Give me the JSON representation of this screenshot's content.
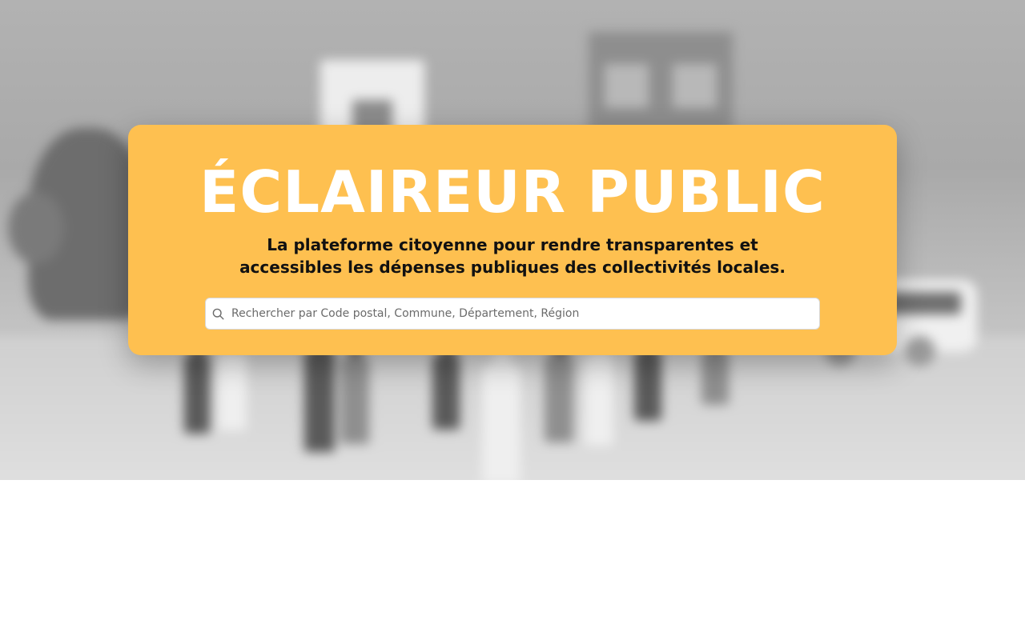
{
  "hero": {
    "title": "ÉCLAIREUR PUBLIC",
    "subtitle": "La plateforme citoyenne pour rendre transparentes et accessibles les dépenses publiques des collectivités locales.",
    "accent_color": "#fec050",
    "title_color": "#ffffff"
  },
  "search": {
    "placeholder": "Rechercher par Code postal, Commune, Département, Région",
    "value": "",
    "icon": "search-icon"
  }
}
